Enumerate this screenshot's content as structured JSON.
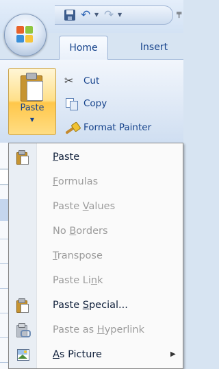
{
  "tabs": [
    "Home",
    "Insert"
  ],
  "ribbon": {
    "paste_label": "Paste",
    "paste_dropdown": "▼",
    "cut_label": "Cut",
    "copy_label": "Copy",
    "format_painter_label": "Format Painter"
  },
  "qat": {
    "dropdown_glyph": "▼",
    "more_glyph": "╤"
  },
  "menu": {
    "items": [
      {
        "pre": "",
        "mn": "P",
        "post": "aste",
        "enabled": true,
        "icon": "paste-icon"
      },
      {
        "pre": "",
        "mn": "F",
        "post": "ormulas",
        "enabled": false,
        "icon": ""
      },
      {
        "pre": "Paste ",
        "mn": "V",
        "post": "alues",
        "enabled": false,
        "icon": ""
      },
      {
        "pre": "No ",
        "mn": "B",
        "post": "orders",
        "enabled": false,
        "icon": ""
      },
      {
        "pre": "",
        "mn": "T",
        "post": "ranspose",
        "enabled": false,
        "icon": ""
      },
      {
        "pre": "Paste Li",
        "mn": "n",
        "post": "k",
        "enabled": false,
        "icon": ""
      },
      {
        "pre": "Paste ",
        "mn": "S",
        "post": "pecial...",
        "enabled": true,
        "icon": "paste-special-icon"
      },
      {
        "pre": "Paste as ",
        "mn": "H",
        "post": "yperlink",
        "enabled": false,
        "icon": "paste-hyperlink-icon"
      },
      {
        "pre": "",
        "mn": "A",
        "post": "s Picture",
        "enabled": true,
        "icon": "picture-icon",
        "submenu": "▶"
      }
    ]
  },
  "colors": {
    "ribbon_text": "#15428b",
    "menu_enabled": "#0f1f3a",
    "menu_disabled": "#9b9b9b",
    "paste_button_highlight": "#ffc74a"
  }
}
